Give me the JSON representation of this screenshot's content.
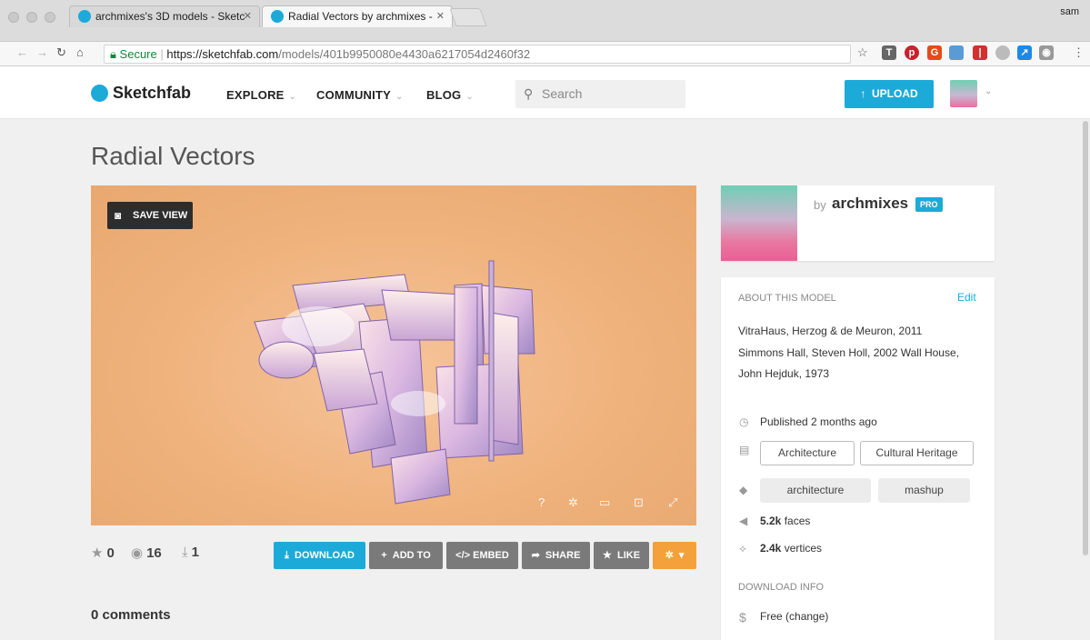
{
  "browser": {
    "tabs": [
      {
        "title": "archmixes's 3D models - Sketc"
      },
      {
        "title": "Radial Vectors by archmixes - "
      }
    ],
    "profile_name": "sam",
    "url": {
      "secure_label": "Secure",
      "scheme_domain": "https://sketchfab.com",
      "path": "/models/401b9950080e4430a6217054d2460f32"
    }
  },
  "site": {
    "logo": "Sketchfab",
    "menu": [
      {
        "label": "EXPLORE"
      },
      {
        "label": "COMMUNITY"
      },
      {
        "label": "BLOG"
      }
    ],
    "search_placeholder": "Search",
    "upload_label": "UPLOAD"
  },
  "model": {
    "title": "Radial Vectors",
    "save_view_label": "SAVE VIEW",
    "stats": {
      "likes": "0",
      "views": "16",
      "downloads": "1"
    },
    "actions": {
      "download": "DOWNLOAD",
      "add_to": "ADD TO",
      "embed": "EMBED",
      "share": "SHARE",
      "like": "LIKE"
    },
    "comments_label": "0 comments"
  },
  "author": {
    "by": "by",
    "name": "archmixes",
    "badge": "PRO"
  },
  "about": {
    "heading": "ABOUT THIS MODEL",
    "edit": "Edit",
    "description_lines": [
      "VitraHaus, Herzog & de Meuron, 2011",
      "Simmons Hall, Steven Holl, 2002 Wall House,",
      "John Hejduk, 1973"
    ],
    "published": "Published 2 months ago",
    "categories": [
      "Architecture",
      "Cultural Heritage"
    ],
    "tags": [
      "architecture",
      "mashup"
    ],
    "faces": "5.2k",
    "faces_label": "faces",
    "vertices": "2.4k",
    "vertices_label": "vertices",
    "download_heading": "DOWNLOAD INFO",
    "price": "Free",
    "price_change": "(change)"
  },
  "colors": {
    "accent": "#1caad9",
    "orange": "#f5a13b",
    "viewer_bg": "#efb27c"
  }
}
